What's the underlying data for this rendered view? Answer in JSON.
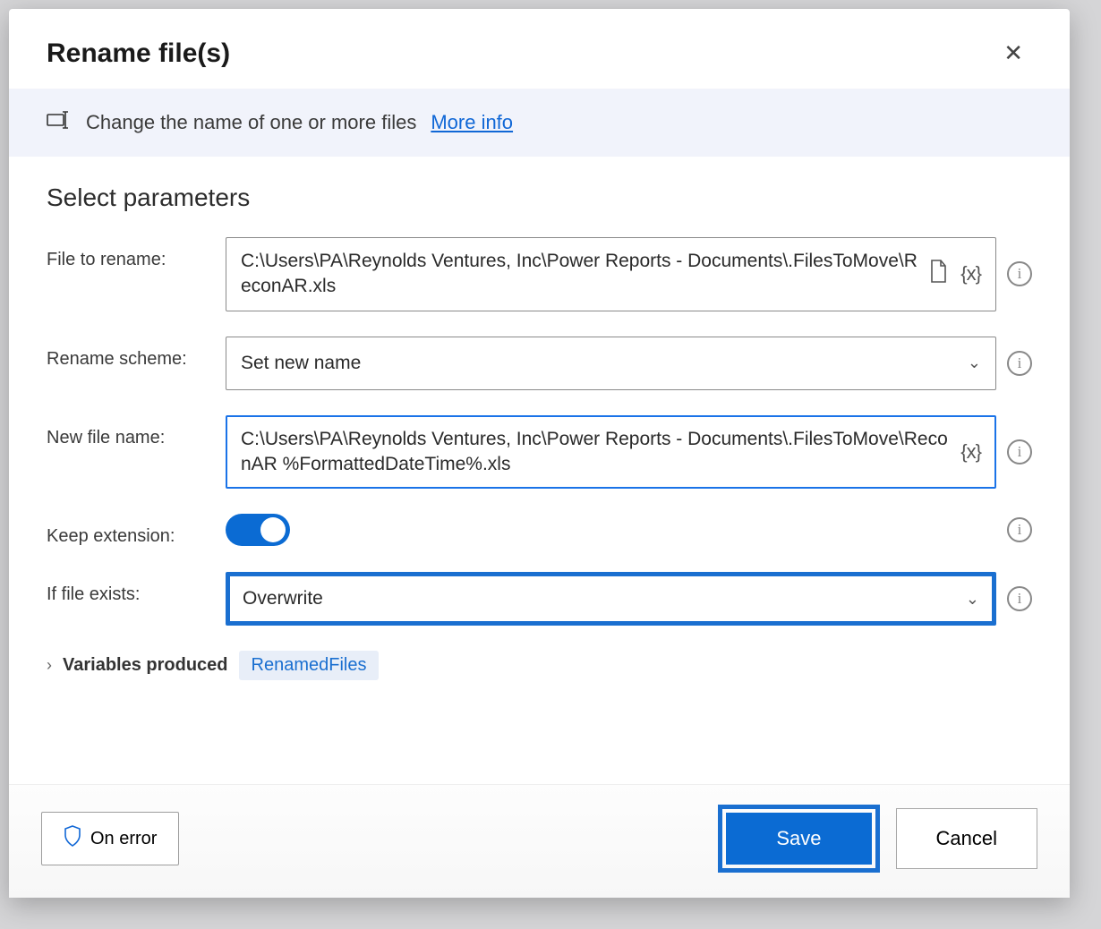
{
  "dialog": {
    "title": "Rename file(s)",
    "description": "Change the name of one or more files",
    "more_info": "More info"
  },
  "section_title": "Select parameters",
  "fields": {
    "file_to_rename": {
      "label": "File to rename:",
      "value": "C:\\Users\\PA\\Reynolds Ventures, Inc\\Power Reports - Documents\\.FilesToMove\\ReconAR.xls"
    },
    "rename_scheme": {
      "label": "Rename scheme:",
      "value": "Set new name"
    },
    "new_file_name": {
      "label": "New file name:",
      "value": "C:\\Users\\PA\\Reynolds Ventures, Inc\\Power Reports - Documents\\.FilesToMove\\ReconAR %FormattedDateTime%.xls"
    },
    "keep_extension": {
      "label": "Keep extension:",
      "value": true
    },
    "if_file_exists": {
      "label": "If file exists:",
      "value": "Overwrite"
    }
  },
  "variables": {
    "label": "Variables produced",
    "chip": "RenamedFiles"
  },
  "buttons": {
    "on_error": "On error",
    "save": "Save",
    "cancel": "Cancel"
  }
}
